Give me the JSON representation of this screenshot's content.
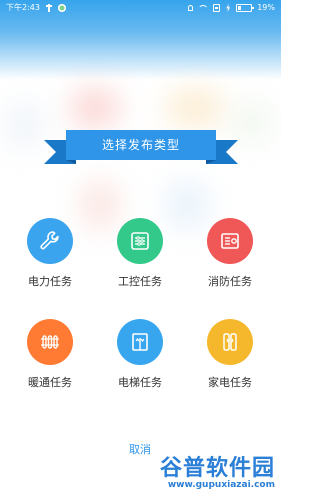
{
  "status_bar": {
    "time": "下午2:43",
    "battery": "19%",
    "icons_left": [
      "usb-icon",
      "app-notification-icon"
    ],
    "icons_right": [
      "bell-off-icon",
      "wifi-icon",
      "sim-icon",
      "charging-icon",
      "battery-icon"
    ]
  },
  "dialog": {
    "title": "选择发布类型",
    "cancel_label": "取消"
  },
  "task_types": [
    {
      "label": "电力任务",
      "icon": "wrench-icon",
      "color": "#3aa4ef"
    },
    {
      "label": "工控任务",
      "icon": "control-panel-icon",
      "color": "#32c98a"
    },
    {
      "label": "消防任务",
      "icon": "fire-alarm-icon",
      "color": "#f05757"
    },
    {
      "label": "暖通任务",
      "icon": "radiator-icon",
      "color": "#ff7a32"
    },
    {
      "label": "电梯任务",
      "icon": "elevator-icon",
      "color": "#38a6ef"
    },
    {
      "label": "家电任务",
      "icon": "appliance-icon",
      "color": "#f5b72b"
    }
  ],
  "watermark": {
    "title": "谷普软件园",
    "url": "www.gupuxiazai.com"
  },
  "colors": {
    "header_blue": "#36a4ec",
    "ribbon_blue": "#2e95e8"
  }
}
